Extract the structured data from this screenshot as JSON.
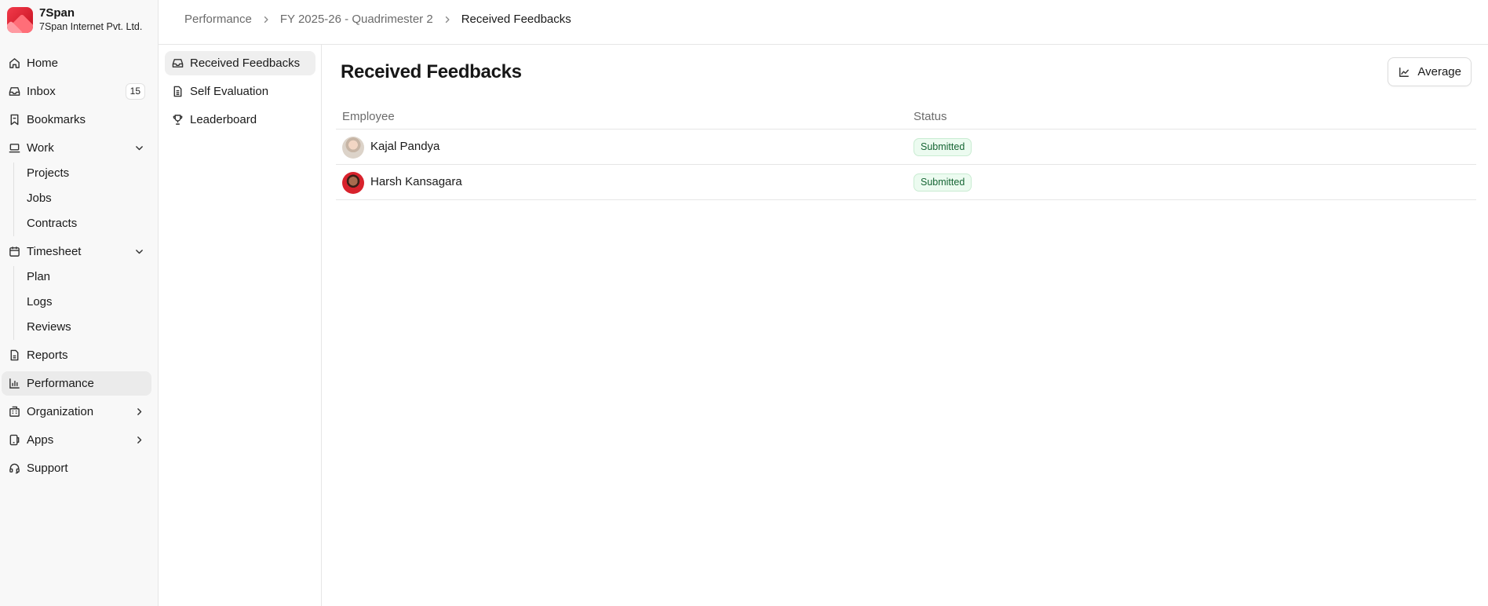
{
  "org": {
    "name": "7Span",
    "subtitle": "7Span Internet Pvt. Ltd."
  },
  "sidebar": {
    "home": "Home",
    "inbox": "Inbox",
    "inbox_count": "15",
    "bookmarks": "Bookmarks",
    "work": "Work",
    "work_items": [
      "Projects",
      "Jobs",
      "Contracts"
    ],
    "timesheet": "Timesheet",
    "timesheet_items": [
      "Plan",
      "Logs",
      "Reviews"
    ],
    "reports": "Reports",
    "performance": "Performance",
    "organization": "Organization",
    "apps": "Apps",
    "support": "Support"
  },
  "breadcrumb": [
    "Performance",
    "FY 2025-26 - Quadrimester 2",
    "Received Feedbacks"
  ],
  "subnav": [
    "Received Feedbacks",
    "Self Evaluation",
    "Leaderboard"
  ],
  "page": {
    "title": "Received Feedbacks",
    "average_button": "Average"
  },
  "table": {
    "columns": [
      "Employee",
      "Status"
    ],
    "rows": [
      {
        "employee": "Kajal Pandya",
        "status": "Submitted"
      },
      {
        "employee": "Harsh Kansagara",
        "status": "Submitted"
      }
    ]
  },
  "colors": {
    "status_bg": "#ecfbf0",
    "status_text": "#166534",
    "brand": "#e0202f",
    "active_nav": "#ebebeb"
  }
}
